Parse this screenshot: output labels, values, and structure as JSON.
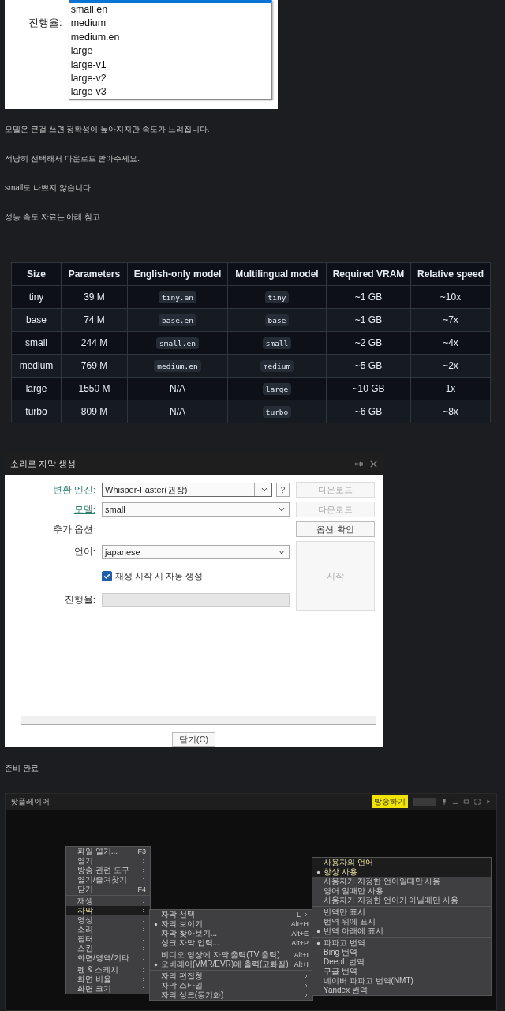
{
  "model_list": {
    "label": "진행율:",
    "options": [
      {
        "label": "small.en",
        "selected": false
      },
      {
        "label": "medium",
        "selected": false
      },
      {
        "label": "medium.en",
        "selected": false
      },
      {
        "label": "large",
        "selected": false
      },
      {
        "label": "large-v1",
        "selected": false
      },
      {
        "label": "large-v2",
        "selected": false
      },
      {
        "label": "large-v3",
        "selected": false
      }
    ]
  },
  "notes": [
    "모델은 큰걸 쓰면 정확성이 높아지지만 속도가 느려집니다.",
    "적당히 선택해서 다운로드 받아주세요.",
    "small도 나쁘지 않습니다.",
    "성능 속도 자료는 아래 참고"
  ],
  "table": {
    "columns": [
      "Size",
      "Parameters",
      "English-only model",
      "Multilingual model",
      "Required VRAM",
      "Relative speed"
    ],
    "rows": [
      {
        "cells": [
          {
            "text": "tiny",
            "kind": "plain"
          },
          {
            "text": "39 M",
            "kind": "plain"
          },
          {
            "text": "tiny.en",
            "kind": "code"
          },
          {
            "text": "tiny",
            "kind": "code"
          },
          {
            "text": "~1 GB",
            "kind": "plain"
          },
          {
            "text": "~10x",
            "kind": "plain"
          }
        ]
      },
      {
        "cells": [
          {
            "text": "base",
            "kind": "plain"
          },
          {
            "text": "74 M",
            "kind": "plain"
          },
          {
            "text": "base.en",
            "kind": "code"
          },
          {
            "text": "base",
            "kind": "code"
          },
          {
            "text": "~1 GB",
            "kind": "plain"
          },
          {
            "text": "~7x",
            "kind": "plain"
          }
        ]
      },
      {
        "cells": [
          {
            "text": "small",
            "kind": "plain"
          },
          {
            "text": "244 M",
            "kind": "plain"
          },
          {
            "text": "small.en",
            "kind": "code"
          },
          {
            "text": "small",
            "kind": "code"
          },
          {
            "text": "~2 GB",
            "kind": "plain"
          },
          {
            "text": "~4x",
            "kind": "plain"
          }
        ]
      },
      {
        "cells": [
          {
            "text": "medium",
            "kind": "plain"
          },
          {
            "text": "769 M",
            "kind": "plain"
          },
          {
            "text": "medium.en",
            "kind": "code"
          },
          {
            "text": "medium",
            "kind": "code"
          },
          {
            "text": "~5 GB",
            "kind": "plain"
          },
          {
            "text": "~2x",
            "kind": "plain"
          }
        ]
      },
      {
        "cells": [
          {
            "text": "large",
            "kind": "plain"
          },
          {
            "text": "1550 M",
            "kind": "plain"
          },
          {
            "text": "N/A",
            "kind": "plain"
          },
          {
            "text": "large",
            "kind": "code"
          },
          {
            "text": "~10 GB",
            "kind": "plain"
          },
          {
            "text": "1x",
            "kind": "plain"
          }
        ]
      },
      {
        "cells": [
          {
            "text": "turbo",
            "kind": "plain"
          },
          {
            "text": "809 M",
            "kind": "plain"
          },
          {
            "text": "N/A",
            "kind": "plain"
          },
          {
            "text": "turbo",
            "kind": "code"
          },
          {
            "text": "~6 GB",
            "kind": "plain"
          },
          {
            "text": "~8x",
            "kind": "plain"
          }
        ]
      }
    ]
  },
  "dialog": {
    "title": "소리로 자막 생성",
    "engine": {
      "label": "변환 엔진:",
      "value": "Whisper-Faster(권장)",
      "help": "?",
      "button": {
        "label": "다운로드",
        "disabled": true
      }
    },
    "model": {
      "label": "모델:",
      "value": "small",
      "button": {
        "label": "다운로드",
        "disabled": true
      }
    },
    "options": {
      "label": "추가 옵션:",
      "button": {
        "label": "옵션 확인",
        "disabled": false
      }
    },
    "language": {
      "label": "언어:",
      "value": "japanese"
    },
    "autostart": {
      "label": "재생 시작 시 자동 생성",
      "checked": true
    },
    "progress": {
      "label": "진행율:",
      "level": 0
    },
    "start_button": {
      "label": "시작",
      "disabled": true
    },
    "close_button": "닫기(C)"
  },
  "status": "준비 완료",
  "player": {
    "title": "팟플레이어",
    "broadcast_button": "방송하기",
    "menus": [
      {
        "items": [
          {
            "kind": "item",
            "label": "파일 열기...",
            "shortcut": "F3",
            "submenu": false,
            "checked": false,
            "selected": false
          },
          {
            "kind": "item",
            "label": "열기",
            "submenu": true,
            "checked": false,
            "selected": false
          },
          {
            "kind": "item",
            "label": "방송 관련 도구",
            "submenu": true,
            "checked": false,
            "selected": false
          },
          {
            "kind": "item",
            "label": "열기/즐겨찾기",
            "submenu": true,
            "checked": false,
            "selected": false
          },
          {
            "kind": "item",
            "label": "닫기",
            "shortcut": "F4",
            "submenu": false,
            "checked": false,
            "selected": false
          },
          {
            "kind": "separator"
          },
          {
            "kind": "item",
            "label": "재생",
            "submenu": true,
            "checked": false,
            "selected": false
          },
          {
            "kind": "item",
            "label": "자막",
            "submenu": true,
            "checked": false,
            "selected": true
          },
          {
            "kind": "item",
            "label": "영상",
            "submenu": true,
            "checked": false,
            "selected": false
          },
          {
            "kind": "item",
            "label": "소리",
            "submenu": true,
            "checked": false,
            "selected": false
          },
          {
            "kind": "item",
            "label": "필터",
            "submenu": true,
            "checked": false,
            "selected": false
          },
          {
            "kind": "item",
            "label": "스킨",
            "submenu": true,
            "checked": false,
            "selected": false
          },
          {
            "kind": "item",
            "label": "화면/영역/기타",
            "submenu": true,
            "checked": false,
            "selected": false
          },
          {
            "kind": "separator"
          },
          {
            "kind": "item",
            "label": "펜 & 스케치",
            "submenu": true,
            "checked": false,
            "selected": false
          },
          {
            "kind": "item",
            "label": "화면 비율",
            "submenu": true,
            "checked": false,
            "selected": false
          },
          {
            "kind": "item",
            "label": "화면 크기",
            "submenu": true,
            "checked": false,
            "selected": false
          }
        ]
      },
      {
        "items": [
          {
            "kind": "item",
            "label": "자막 선택",
            "shortcut": "L",
            "submenu": true,
            "checked": false,
            "selected": false
          },
          {
            "kind": "item",
            "label": "자막 보이기",
            "shortcut": "Alt+H",
            "submenu": false,
            "checked": true,
            "selected": false
          },
          {
            "kind": "item",
            "label": "자막 찾아보기...",
            "shortcut": "Alt+E",
            "submenu": false,
            "checked": false,
            "selected": false
          },
          {
            "kind": "item",
            "label": "싱크 자막 입력...",
            "shortcut": "Alt+P",
            "submenu": false,
            "checked": false,
            "selected": false
          },
          {
            "kind": "separator"
          },
          {
            "kind": "item",
            "label": "비디오 영상에 자막 출력(TV 출력)",
            "shortcut": "Alt+I",
            "submenu": false,
            "checked": false,
            "selected": false
          },
          {
            "kind": "item",
            "label": "오버레이(VMR/EVR)에 출력(고화질)",
            "shortcut": "Alt+I",
            "submenu": false,
            "checked": true,
            "selected": false
          },
          {
            "kind": "separator"
          },
          {
            "kind": "item",
            "label": "자막 편집창",
            "submenu": true,
            "checked": false,
            "selected": false
          },
          {
            "kind": "item",
            "label": "자막 스타일",
            "submenu": true,
            "checked": false,
            "selected": false
          },
          {
            "kind": "item",
            "label": "자막 싱크(동기화)",
            "submenu": true,
            "checked": false,
            "selected": false
          }
        ]
      },
      {
        "items": [
          {
            "kind": "item",
            "label": "사용자의 언어",
            "submenu": false,
            "checked": false,
            "selected": true
          },
          {
            "kind": "item",
            "label": "항상 사용",
            "submenu": false,
            "checked": true,
            "selected": true
          },
          {
            "kind": "item",
            "label": "사용자가 지정한 언어일때만 사용",
            "submenu": false,
            "checked": false,
            "selected": false
          },
          {
            "kind": "item",
            "label": "영어 일때만 사용",
            "submenu": false,
            "checked": false,
            "selected": false
          },
          {
            "kind": "item",
            "label": "사용자가 지정한 언어가 아닐때만 사용",
            "submenu": false,
            "checked": false,
            "selected": false
          },
          {
            "kind": "separator"
          },
          {
            "kind": "item",
            "label": "번역만 표시",
            "submenu": false,
            "checked": false,
            "selected": false
          },
          {
            "kind": "item",
            "label": "번역 위에 표시",
            "submenu": false,
            "checked": false,
            "selected": false
          },
          {
            "kind": "item",
            "label": "번역 아래에 표시",
            "submenu": false,
            "checked": true,
            "selected": false
          },
          {
            "kind": "separator"
          },
          {
            "kind": "item",
            "label": "파파고 번역",
            "submenu": false,
            "checked": true,
            "selected": false
          },
          {
            "kind": "item",
            "label": "Bing 번역",
            "submenu": false,
            "checked": false,
            "selected": false
          },
          {
            "kind": "item",
            "label": "DeepL 번역",
            "submenu": false,
            "checked": false,
            "selected": false
          },
          {
            "kind": "item",
            "label": "구글 번역",
            "submenu": false,
            "checked": false,
            "selected": false
          },
          {
            "kind": "item",
            "label": "네이버 파파고 번역(NMT)",
            "submenu": false,
            "checked": false,
            "selected": false
          },
          {
            "kind": "item",
            "label": "Yandex 번역",
            "submenu": false,
            "checked": false,
            "selected": false
          }
        ]
      }
    ]
  }
}
